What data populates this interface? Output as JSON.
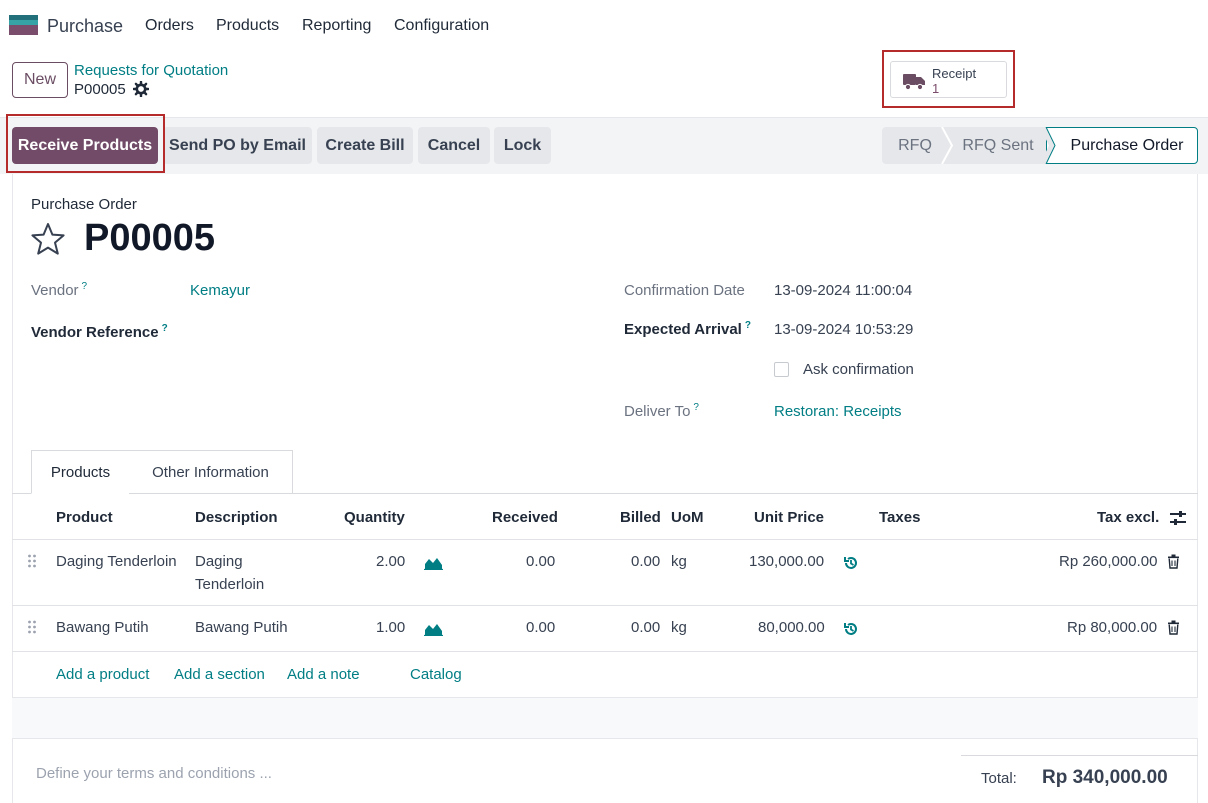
{
  "nav": {
    "app_name": "Purchase",
    "menu": [
      "Orders",
      "Products",
      "Reporting",
      "Configuration"
    ]
  },
  "control": {
    "new_label": "New",
    "breadcrumb_parent": "Requests for Quotation",
    "breadcrumb_current": "P00005",
    "smart_button": {
      "label": "Receipt",
      "count": "1",
      "icon": "truck-icon"
    }
  },
  "actions": [
    "Receive Products",
    "Send PO by Email",
    "Create Bill",
    "Cancel",
    "Lock"
  ],
  "statusbar": {
    "steps": [
      "RFQ",
      "RFQ Sent",
      "Purchase Order"
    ],
    "active": "Purchase Order"
  },
  "form": {
    "kind_label": "Purchase Order",
    "name": "P00005",
    "vendor_label": "Vendor",
    "vendor_value": "Kemayur",
    "vendor_ref_label": "Vendor Reference",
    "confirmation_date_label": "Confirmation Date",
    "confirmation_date_value": "13-09-2024 11:00:04",
    "expected_arrival_label": "Expected Arrival",
    "expected_arrival_value": "13-09-2024 10:53:29",
    "ask_confirmation_label": "Ask confirmation",
    "deliver_to_label": "Deliver To",
    "deliver_to_value": "Restoran: Receipts",
    "help_mark": "?"
  },
  "tabs": [
    "Products",
    "Other Information"
  ],
  "table": {
    "headers": [
      "Product",
      "Description",
      "Quantity",
      "Received",
      "Billed",
      "UoM",
      "Unit Price",
      "Taxes",
      "Tax excl."
    ],
    "rows": [
      {
        "product": "Daging Tenderloin",
        "description_1": "Daging",
        "description_2": "Tenderloin",
        "quantity": "2.00",
        "received": "0.00",
        "billed": "0.00",
        "uom": "kg",
        "unit_price": "130,000.00",
        "subtotal": "Rp 260,000.00"
      },
      {
        "product": "Bawang Putih",
        "description_1": "Bawang Putih",
        "description_2": "",
        "quantity": "1.00",
        "received": "0.00",
        "billed": "0.00",
        "uom": "kg",
        "unit_price": "80,000.00",
        "subtotal": "Rp 80,000.00"
      }
    ],
    "add_links": [
      "Add a product",
      "Add a section",
      "Add a note",
      "Catalog"
    ]
  },
  "footer": {
    "terms_placeholder": "Define your terms and conditions ...",
    "total_label": "Total:",
    "total_value": "Rp 340,000.00"
  }
}
